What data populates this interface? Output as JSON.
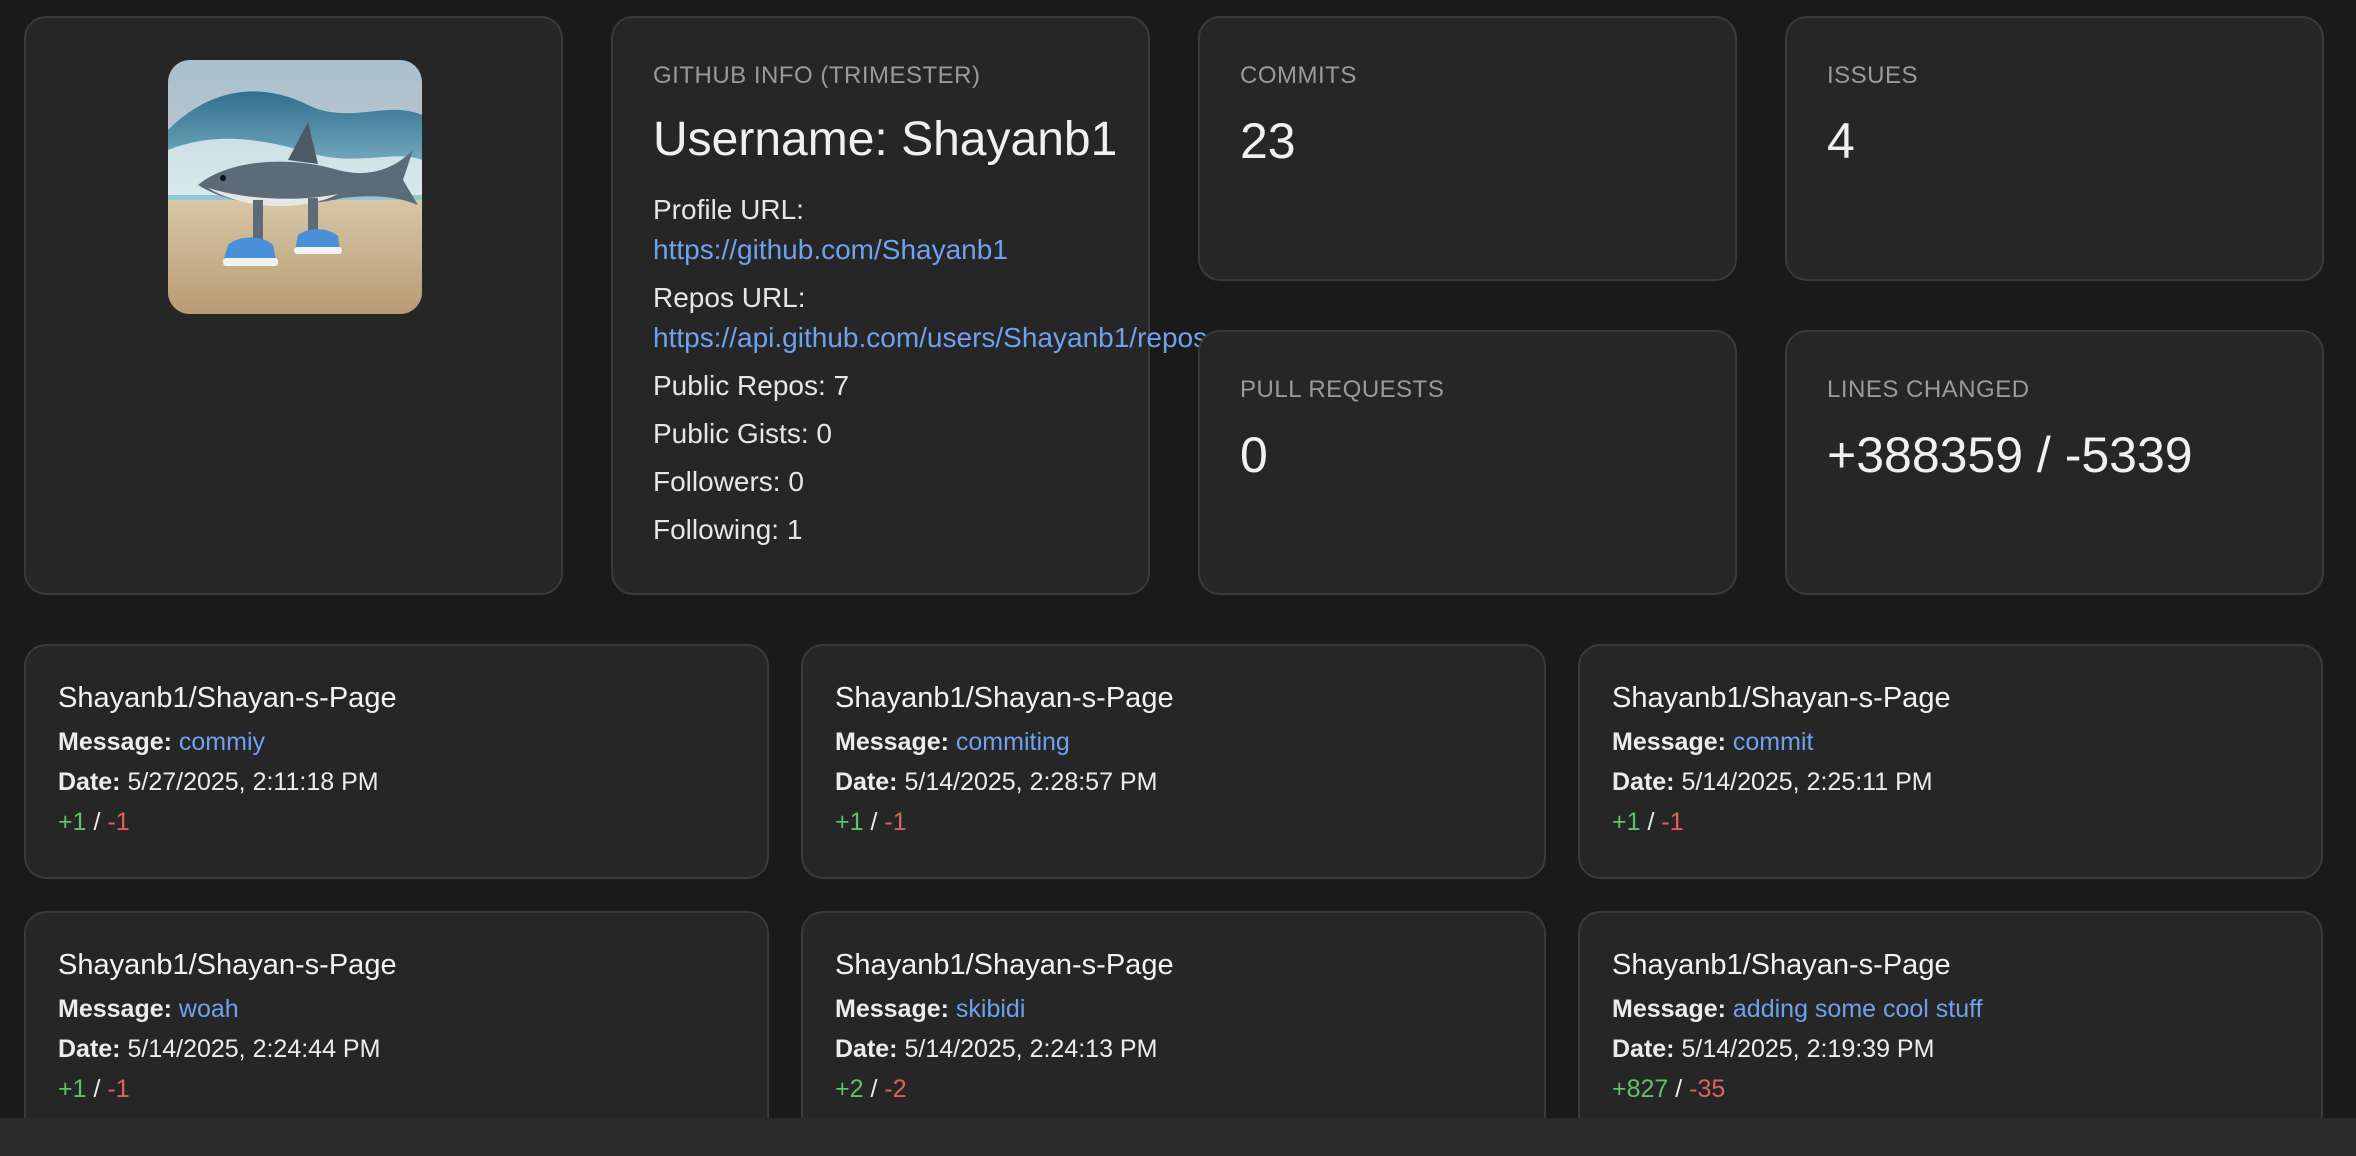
{
  "colors": {
    "background": "#1a1a1a",
    "card": "#262626",
    "link": "#6ea2ee",
    "additions": "#5fc26a",
    "deletions": "#e0625e"
  },
  "profile": {
    "avatar_alt": "shark wearing sneakers avatar"
  },
  "github_info": {
    "label": "GITHUB INFO (TRIMESTER)",
    "username_line": "Username: Shayanb1",
    "profile_url_label": "Profile URL:",
    "profile_url": "https://github.com/Shayanb1",
    "repos_url_label": "Repos URL:",
    "repos_url": "https://api.github.com/users/Shayanb1/repos",
    "public_repos": "Public Repos: 7",
    "public_gists": "Public Gists: 0",
    "followers": "Followers: 0",
    "following": "Following: 1"
  },
  "stats": {
    "commits": {
      "label": "COMMITS",
      "value": "23"
    },
    "issues": {
      "label": "ISSUES",
      "value": "4"
    },
    "pull_requests": {
      "label": "PULL REQUESTS",
      "value": "0"
    },
    "lines_changed": {
      "label": "LINES CHANGED",
      "value": "+388359 / -5339"
    }
  },
  "commit_labels": {
    "message": "Message:",
    "date": "Date:",
    "separator": "/"
  },
  "commits": [
    {
      "repo": "Shayanb1/Shayan-s-Page",
      "message": "commiy",
      "date": "5/27/2025, 2:11:18 PM",
      "additions": "+1",
      "deletions": "-1"
    },
    {
      "repo": "Shayanb1/Shayan-s-Page",
      "message": "commiting",
      "date": "5/14/2025, 2:28:57 PM",
      "additions": "+1",
      "deletions": "-1"
    },
    {
      "repo": "Shayanb1/Shayan-s-Page",
      "message": "commit",
      "date": "5/14/2025, 2:25:11 PM",
      "additions": "+1",
      "deletions": "-1"
    },
    {
      "repo": "Shayanb1/Shayan-s-Page",
      "message": "woah",
      "date": "5/14/2025, 2:24:44 PM",
      "additions": "+1",
      "deletions": "-1"
    },
    {
      "repo": "Shayanb1/Shayan-s-Page",
      "message": "skibidi",
      "date": "5/14/2025, 2:24:13 PM",
      "additions": "+2",
      "deletions": "-2"
    },
    {
      "repo": "Shayanb1/Shayan-s-Page",
      "message": "adding some cool stuff",
      "date": "5/14/2025, 2:19:39 PM",
      "additions": "+827",
      "deletions": "-35"
    }
  ]
}
